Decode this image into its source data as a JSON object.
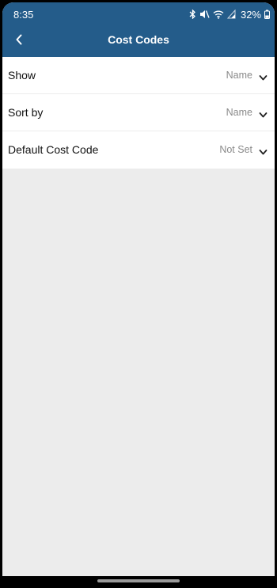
{
  "status_bar": {
    "time": "8:35",
    "battery": "32%",
    "icons": [
      "bluetooth-icon",
      "mute-icon",
      "wifi-icon",
      "signal-icon",
      "battery-icon"
    ]
  },
  "header": {
    "title": "Cost Codes",
    "back_icon": "chevron-left-icon",
    "background_color": "#245c8a"
  },
  "settings": {
    "rows": [
      {
        "label": "Show",
        "value": "Name"
      },
      {
        "label": "Sort by",
        "value": "Name"
      },
      {
        "label": "Default Cost Code",
        "value": "Not Set"
      }
    ]
  }
}
